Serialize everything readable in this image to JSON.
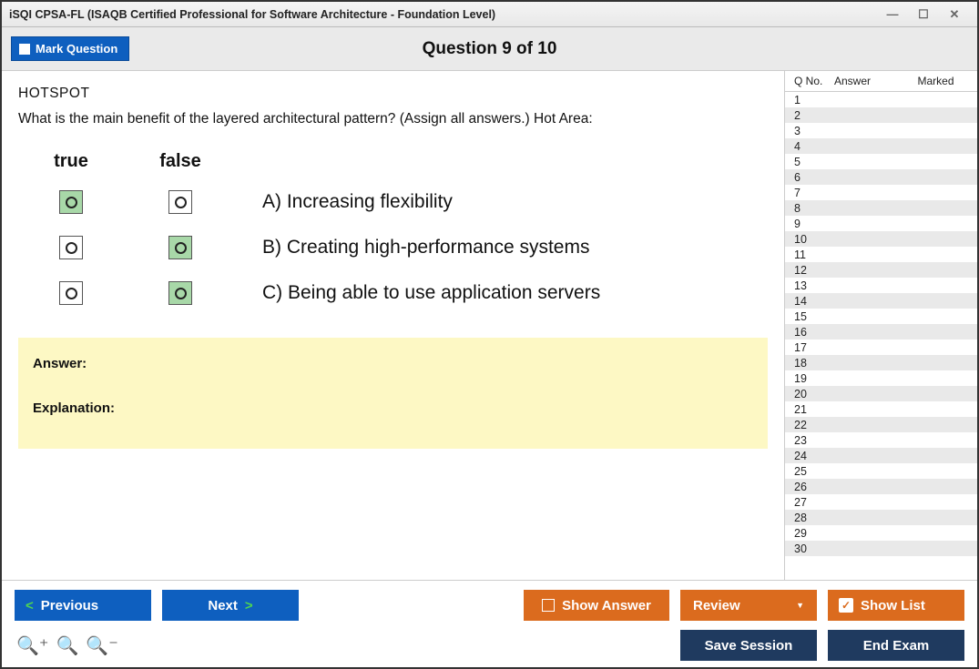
{
  "window": {
    "title": "iSQI CPSA-FL (ISAQB Certified Professional for Software Architecture - Foundation Level)"
  },
  "header": {
    "mark_label": "Mark Question",
    "counter": "Question 9 of 10"
  },
  "question": {
    "type": "HOTSPOT",
    "text": "What is the main benefit of the layered architectural pattern? (Assign all answers.) Hot Area:",
    "col_true": "true",
    "col_false": "false",
    "options": [
      {
        "label": "A) Increasing flexibility",
        "true_selected": true,
        "false_selected": false
      },
      {
        "label": "B) Creating high-performance systems",
        "true_selected": false,
        "false_selected": true
      },
      {
        "label": "C) Being able to use application servers",
        "true_selected": false,
        "false_selected": true
      }
    ]
  },
  "answerbox": {
    "answer_label": "Answer:",
    "explanation_label": "Explanation:"
  },
  "navigator": {
    "headers": {
      "qno": "Q No.",
      "answer": "Answer",
      "marked": "Marked"
    },
    "rows": [
      1,
      2,
      3,
      4,
      5,
      6,
      7,
      8,
      9,
      10,
      11,
      12,
      13,
      14,
      15,
      16,
      17,
      18,
      19,
      20,
      21,
      22,
      23,
      24,
      25,
      26,
      27,
      28,
      29,
      30
    ]
  },
  "buttons": {
    "previous": "Previous",
    "next": "Next",
    "show_answer": "Show Answer",
    "review": "Review",
    "show_list": "Show List",
    "save_session": "Save Session",
    "end_exam": "End Exam"
  }
}
